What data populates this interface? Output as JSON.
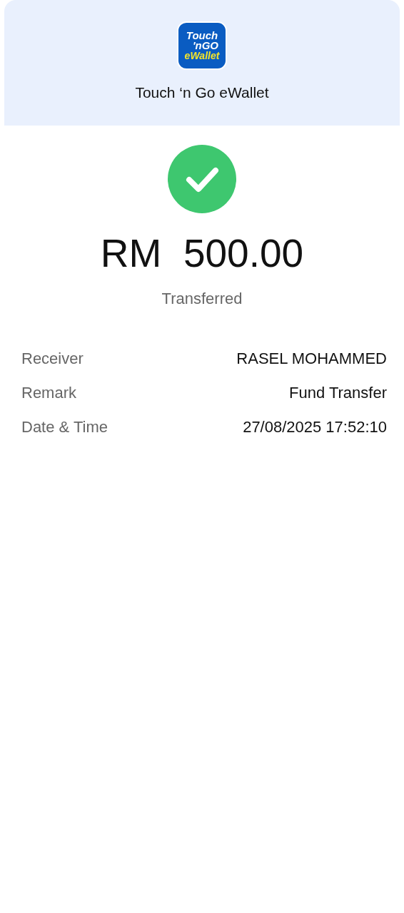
{
  "header": {
    "logo": {
      "lines": [
        "Touch",
        "'nGO",
        "eWallet"
      ]
    },
    "title": "Touch ‘n Go eWallet"
  },
  "status": {
    "kind": "success",
    "amount": "RM  500.00",
    "label": "Transferred"
  },
  "details": [
    {
      "label": "Receiver",
      "value": "RASEL MOHAMMED"
    },
    {
      "label": "Remark",
      "value": "Fund Transfer"
    },
    {
      "label": "Date & Time",
      "value": "27/08/2025 17:52:10"
    }
  ]
}
